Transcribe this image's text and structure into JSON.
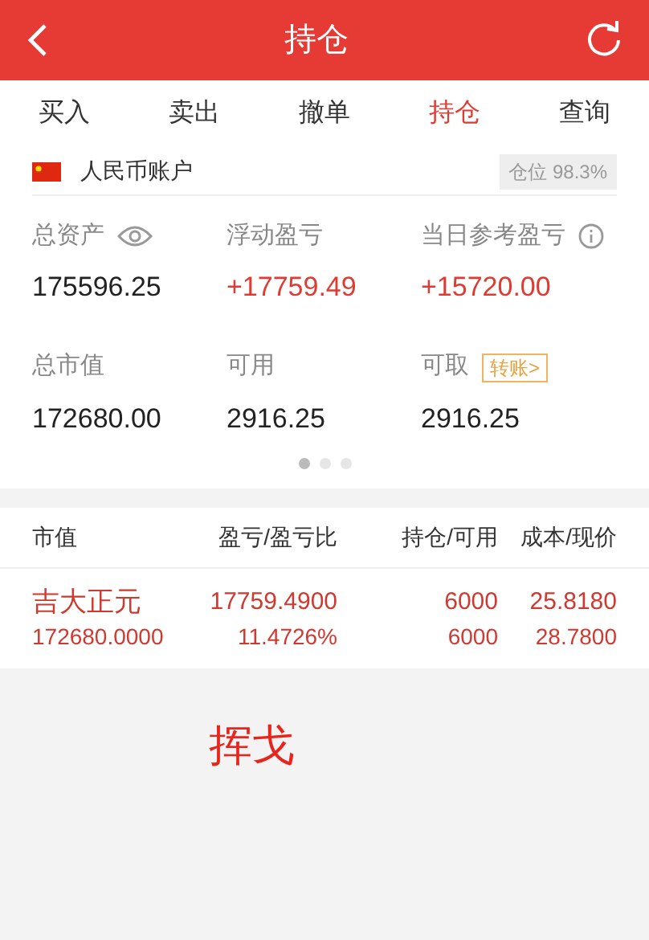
{
  "header": {
    "title": "持仓"
  },
  "tabs": [
    {
      "label": "买入",
      "selected": false
    },
    {
      "label": "卖出",
      "selected": false
    },
    {
      "label": "撤单",
      "selected": false
    },
    {
      "label": "持仓",
      "selected": true
    },
    {
      "label": "查询",
      "selected": false
    }
  ],
  "account": {
    "name": "人民币账户",
    "position_ratio": "仓位 98.3%"
  },
  "stats": [
    {
      "label": "总资产",
      "value": "175596.25",
      "kind": "eye",
      "positive": false
    },
    {
      "label": "浮动盈亏",
      "value": "+17759.49",
      "kind": "plain",
      "positive": true
    },
    {
      "label": "当日参考盈亏",
      "value": "+15720.00",
      "kind": "info",
      "positive": true
    },
    {
      "label": "总市值",
      "value": "172680.00",
      "kind": "plain",
      "positive": false
    },
    {
      "label": "可用",
      "value": "2916.25",
      "kind": "plain",
      "positive": false
    },
    {
      "label": "可取",
      "value": "2916.25",
      "kind": "transfer",
      "action": "转账>",
      "positive": false
    }
  ],
  "pager": [
    {
      "selected": true
    },
    {
      "selected": false
    },
    {
      "selected": false
    }
  ],
  "table": {
    "columns": [
      "市值",
      "盈亏/盈亏比",
      "持仓/可用",
      "成本/现价"
    ],
    "rows": [
      {
        "cells": [
          [
            "吉大正元",
            "172680.0000"
          ],
          [
            "17759.4900",
            "11.4726%"
          ],
          [
            "6000",
            "6000"
          ],
          [
            "25.8180",
            "28.7800"
          ]
        ]
      }
    ]
  },
  "note": "挥戈"
}
